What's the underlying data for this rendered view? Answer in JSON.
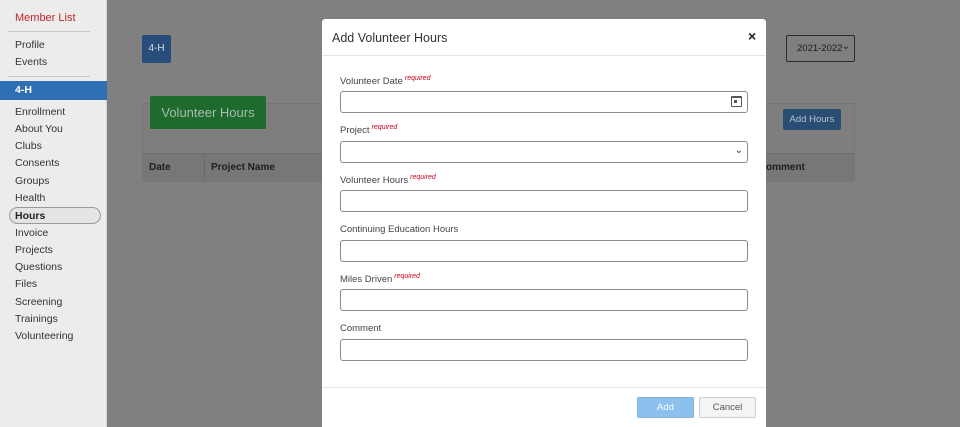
{
  "sidebar": {
    "member_list": "Member List",
    "top_items": [
      "Profile",
      "Events"
    ],
    "active_section": "4-H",
    "items": [
      "Enrollment",
      "About You",
      "Clubs",
      "Consents",
      "Groups",
      "Health",
      "Hours",
      "Invoice",
      "Projects",
      "Questions",
      "Files",
      "Screening",
      "Trainings",
      "Volunteering"
    ],
    "selected_item": "Hours"
  },
  "main": {
    "program_button": "4-H",
    "year_select": "2021-2022",
    "panel_title": "Volunteer Hours",
    "add_hours_button": "Add Hours",
    "table_headers": [
      "Date",
      "Project Name",
      "omment"
    ]
  },
  "modal": {
    "title": "Add Volunteer Hours",
    "close": "×",
    "required_text": "required",
    "fields": {
      "volunteer_date": "Volunteer Date",
      "project": "Project",
      "volunteer_hours": "Volunteer Hours",
      "continuing_education_hours": "Continuing Education Hours",
      "miles_driven": "Miles Driven",
      "comment": "Comment"
    },
    "add_button": "Add",
    "cancel_button": "Cancel"
  },
  "colors": {
    "accent": "#2f6fb4",
    "required": "#d0021b",
    "member_list": "#c0262d"
  }
}
